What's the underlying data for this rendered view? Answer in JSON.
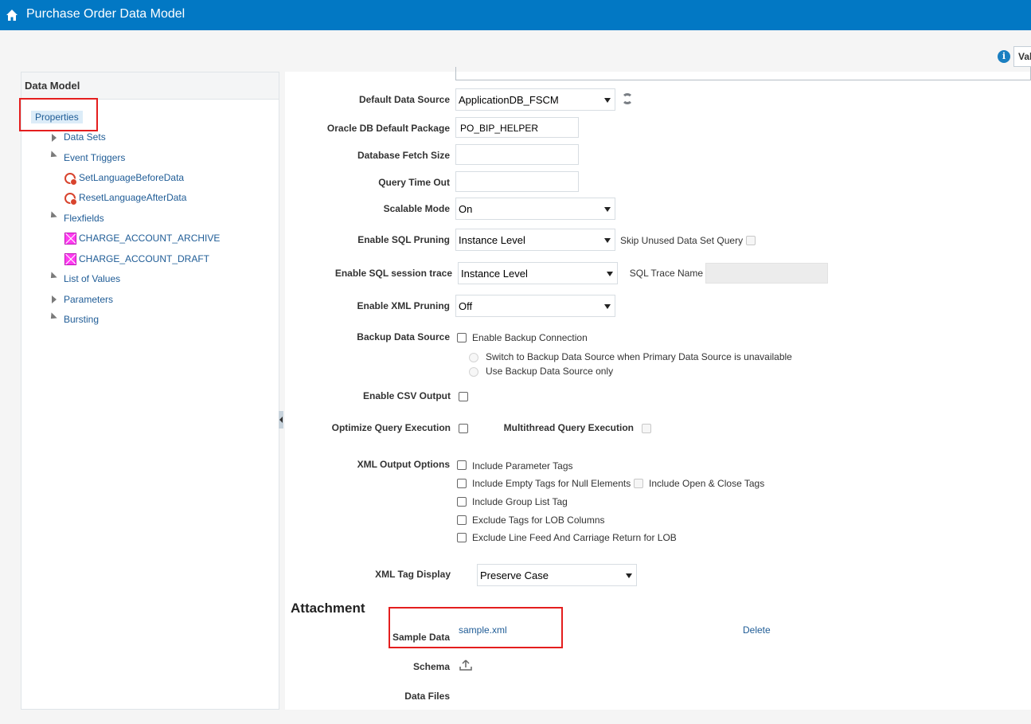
{
  "header": {
    "title": "Purchase Order Data Model",
    "home_icon": "home-icon"
  },
  "toolbar": {
    "info_icon": "info-icon",
    "validate_label": "Val"
  },
  "left_panel": {
    "title": "Data Model",
    "selected": "Properties",
    "items": [
      {
        "label": "Data Sets",
        "expander": "collapsed"
      },
      {
        "label": "Event Triggers",
        "expander": "expanded"
      },
      {
        "label": "SetLanguageBeforeData",
        "icon": "event-trigger-icon"
      },
      {
        "label": "ResetLanguageAfterData",
        "icon": "event-trigger-icon"
      },
      {
        "label": "Flexfields",
        "expander": "expanded"
      },
      {
        "label": "CHARGE_ACCOUNT_ARCHIVE",
        "icon": "flexfield-icon"
      },
      {
        "label": "CHARGE_ACCOUNT_DRAFT",
        "icon": "flexfield-icon"
      },
      {
        "label": "List of Values",
        "expander": "expanded"
      },
      {
        "label": "Parameters",
        "expander": "collapsed"
      },
      {
        "label": "Bursting",
        "expander": "expanded"
      }
    ]
  },
  "form": {
    "default_data_source": {
      "label": "Default Data Source",
      "value": "ApplicationDB_FSCM"
    },
    "oracle_db_default_package": {
      "label": "Oracle DB Default Package",
      "value": "PO_BIP_HELPER"
    },
    "database_fetch_size": {
      "label": "Database Fetch Size",
      "value": ""
    },
    "query_time_out": {
      "label": "Query Time Out",
      "value": ""
    },
    "scalable_mode": {
      "label": "Scalable Mode",
      "value": "On"
    },
    "enable_sql_pruning": {
      "label": "Enable SQL Pruning",
      "value": "Instance Level",
      "skip_label": "Skip Unused Data Set Query"
    },
    "enable_sql_session_trace": {
      "label": "Enable SQL session trace",
      "value": "Instance Level",
      "trace_name_label": "SQL Trace Name",
      "trace_name_value": ""
    },
    "enable_xml_pruning": {
      "label": "Enable XML Pruning",
      "value": "Off"
    },
    "backup_data_source": {
      "label": "Backup Data Source",
      "checkbox_label": "Enable Backup Connection",
      "radio1": "Switch to Backup Data Source when Primary Data Source is unavailable",
      "radio2": "Use Backup Data Source only"
    },
    "enable_csv_output": {
      "label": "Enable CSV Output"
    },
    "optimize_query_execution": {
      "label": "Optimize Query Execution",
      "multithread_label": "Multithread Query Execution"
    },
    "xml_output_options": {
      "label": "XML Output Options",
      "include_parameter_tags": "Include Parameter Tags",
      "include_empty_tags": "Include Empty Tags for Null Elements",
      "include_open_close_tags": "Include Open & Close Tags",
      "include_group_list_tag": "Include Group List Tag",
      "exclude_tags_lob": "Exclude Tags for LOB Columns",
      "exclude_line_feed": "Exclude Line Feed And Carriage Return for LOB"
    },
    "xml_tag_display": {
      "label": "XML Tag Display",
      "value": "Preserve Case"
    }
  },
  "attachment": {
    "title": "Attachment",
    "sample_data_label": "Sample Data",
    "sample_file": "sample.xml",
    "delete_label": "Delete",
    "schema_label": "Schema",
    "data_files_label": "Data Files"
  },
  "colors": {
    "header_bg": "#0278c4",
    "link": "#1f5c96",
    "highlight_box": "#e41e1e"
  }
}
